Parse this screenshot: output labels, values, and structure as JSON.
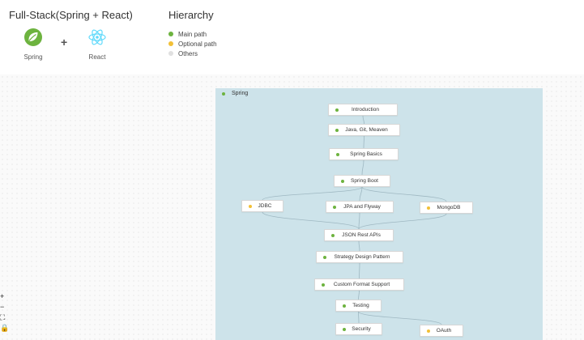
{
  "header": {
    "title": "Full-Stack(Spring + React)",
    "logos": [
      {
        "label": "Spring",
        "icon": "spring-leaf-icon",
        "color": "#6db33f"
      },
      {
        "label": "React",
        "icon": "react-atom-icon",
        "color": "#61dafb"
      }
    ],
    "plus": "+"
  },
  "hierarchy": {
    "title": "Hierarchy",
    "items": [
      {
        "label": "Main path",
        "color": "#6db33f"
      },
      {
        "label": "Optional path",
        "color": "#f2c037"
      },
      {
        "label": "Others",
        "color": "#e0e0e0"
      }
    ]
  },
  "roadmap": {
    "group": {
      "label": "Spring",
      "color": "#6db33f"
    },
    "nodes": [
      {
        "id": "introduction",
        "label": "Introduction",
        "type": "main"
      },
      {
        "id": "java-git-meaven",
        "label": "Java, Git, Meaven",
        "type": "main"
      },
      {
        "id": "spring-basics",
        "label": "Spring Basics",
        "type": "main"
      },
      {
        "id": "spring-boot",
        "label": "Spring Boot",
        "type": "main"
      },
      {
        "id": "jdbc",
        "label": "JDBC",
        "type": "optional"
      },
      {
        "id": "jpa-and-flyway",
        "label": "JPA and Flyway",
        "type": "main"
      },
      {
        "id": "mongodb",
        "label": "MongoDB",
        "type": "optional"
      },
      {
        "id": "json-rest-apis",
        "label": "JSON Rest APIs",
        "type": "main"
      },
      {
        "id": "strategy-design-pattern",
        "label": "Strategy Design Pattern",
        "type": "main"
      },
      {
        "id": "custom-format-support",
        "label": "Custom Format Support",
        "type": "main"
      },
      {
        "id": "testing",
        "label": "Testing",
        "type": "main"
      },
      {
        "id": "security",
        "label": "Security",
        "type": "main"
      },
      {
        "id": "oauth",
        "label": "OAuth",
        "type": "optional"
      }
    ],
    "edges": [
      [
        "introduction",
        "java-git-meaven"
      ],
      [
        "java-git-meaven",
        "spring-basics"
      ],
      [
        "spring-basics",
        "spring-boot"
      ],
      [
        "spring-boot",
        "jdbc"
      ],
      [
        "spring-boot",
        "jpa-and-flyway"
      ],
      [
        "spring-boot",
        "mongodb"
      ],
      [
        "jdbc",
        "json-rest-apis"
      ],
      [
        "jpa-and-flyway",
        "json-rest-apis"
      ],
      [
        "mongodb",
        "json-rest-apis"
      ],
      [
        "json-rest-apis",
        "strategy-design-pattern"
      ],
      [
        "strategy-design-pattern",
        "custom-format-support"
      ],
      [
        "custom-format-support",
        "testing"
      ],
      [
        "testing",
        "security"
      ],
      [
        "testing",
        "oauth"
      ]
    ],
    "colors": {
      "main": "#6db33f",
      "optional": "#f2c037",
      "other": "#e0e0e0"
    }
  },
  "zoom_controls": [
    {
      "label": "+",
      "icon": "zoom-in-icon"
    },
    {
      "label": "−",
      "icon": "zoom-out-icon"
    },
    {
      "label": "⛶",
      "icon": "fit-view-icon"
    },
    {
      "label": "🔒",
      "icon": "lock-icon"
    }
  ]
}
